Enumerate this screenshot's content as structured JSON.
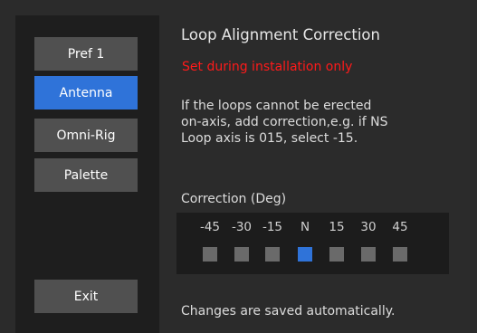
{
  "sidebar": {
    "buttons": [
      {
        "label": "Pref 1",
        "active": false
      },
      {
        "label": "Antenna",
        "active": true
      },
      {
        "label": "Omni-Rig",
        "active": false
      },
      {
        "label": "Palette",
        "active": false
      }
    ],
    "exit_label": "Exit"
  },
  "main": {
    "title": "Loop Alignment Correction",
    "warning": "Set during installation only",
    "description_lines": [
      "If the loops cannot be erected",
      "on-axis, add correction,e.g. if NS",
      "Loop axis is 015, select -15."
    ],
    "correction_label": "Correction (Deg)",
    "correction_options": [
      "-45",
      "-30",
      "-15",
      "N",
      "15",
      "30",
      "45"
    ],
    "selected_option": "N",
    "footer": "Changes are saved automatically."
  },
  "colors": {
    "accent": "#2f73d9",
    "warning": "#ff1a1a",
    "button": "#505050",
    "unselected_box": "#6a6a6a"
  }
}
